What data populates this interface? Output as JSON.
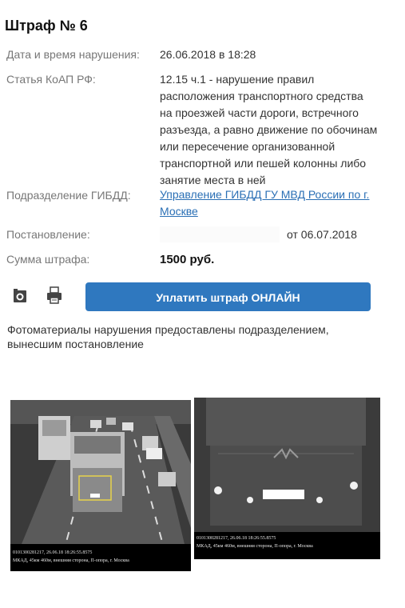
{
  "fine": {
    "title": "Штраф № 6",
    "datetime_label": "Дата и время нарушения:",
    "datetime_value": "26.06.2018 в 18:28",
    "article_label": "Статья КоАП РФ:",
    "article_lines": [
      "12.15 ч.1 - нарушение правил",
      "расположения транспортного средства",
      "на проезжей части дороги, встречного",
      "разъезда, а равно движение по обочинам",
      "или пересечение организованной",
      "транспортной или пешей колонны либо",
      "занятие места в ней"
    ],
    "division_label": "Подразделение ГИБДД:",
    "division_line1": "Управление ГИБДД ГУ МВД России по г.",
    "division_line2": "Москве",
    "resolution_label": "Постановление:",
    "resolution_date": "от 06.07.2018",
    "amount_label": "Сумма штрафа:",
    "amount_value": "1500 руб."
  },
  "actions": {
    "pay_button": "Уплатить штраф ОНЛАЙН",
    "camera_icon": "camera-icon",
    "print_icon": "printer-icon"
  },
  "photos": {
    "note_line1": "Фотоматериалы нарушения предоставлены подразделением,",
    "note_line2": "вынесшим постановление",
    "caption_line1": "0101300281217, 26.06.18 18:26:55.8575",
    "caption_line2": "МКАД, 45км 460м, внешняя сторона, П-опора, г. Москва",
    "caption2_line1": "0101300281217, 26.06.18 18:26:55.8575",
    "caption2_line2": "МКАД, 45км 460м, внешняя сторона, П-опора, г. Москва"
  }
}
